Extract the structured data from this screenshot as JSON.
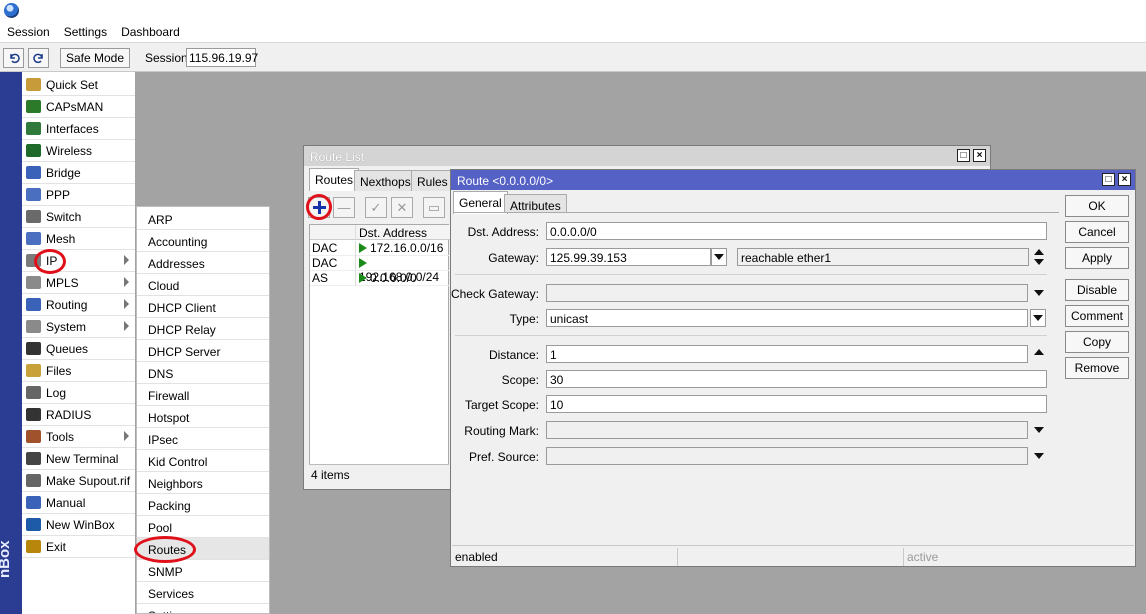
{
  "menubar": {
    "items": [
      "Session",
      "Settings",
      "Dashboard"
    ]
  },
  "toolbar": {
    "undo_icon": "undo-icon",
    "redo_icon": "redo-icon",
    "safe_mode_label": "Safe Mode",
    "session_label": "Session:",
    "session_value": "115.96.19.97"
  },
  "brand": {
    "text": "nBox"
  },
  "sidebar": {
    "items": [
      {
        "label": "Quick Set",
        "icon": "quick-set-icon",
        "arrow": false
      },
      {
        "label": "CAPsMAN",
        "icon": "capsman-icon",
        "arrow": false
      },
      {
        "label": "Interfaces",
        "icon": "interfaces-icon",
        "arrow": false
      },
      {
        "label": "Wireless",
        "icon": "wireless-icon",
        "arrow": false
      },
      {
        "label": "Bridge",
        "icon": "bridge-icon",
        "arrow": false
      },
      {
        "label": "PPP",
        "icon": "ppp-icon",
        "arrow": false
      },
      {
        "label": "Switch",
        "icon": "switch-icon",
        "arrow": false
      },
      {
        "label": "Mesh",
        "icon": "mesh-icon",
        "arrow": false
      },
      {
        "label": "IP",
        "icon": "ip-icon",
        "arrow": true
      },
      {
        "label": "MPLS",
        "icon": "mpls-icon",
        "arrow": true
      },
      {
        "label": "Routing",
        "icon": "routing-icon",
        "arrow": true
      },
      {
        "label": "System",
        "icon": "system-icon",
        "arrow": true
      },
      {
        "label": "Queues",
        "icon": "queues-icon",
        "arrow": false
      },
      {
        "label": "Files",
        "icon": "files-icon",
        "arrow": false
      },
      {
        "label": "Log",
        "icon": "log-icon",
        "arrow": false
      },
      {
        "label": "RADIUS",
        "icon": "radius-icon",
        "arrow": false
      },
      {
        "label": "Tools",
        "icon": "tools-icon",
        "arrow": true
      },
      {
        "label": "New Terminal",
        "icon": "terminal-icon",
        "arrow": false
      },
      {
        "label": "Make Supout.rif",
        "icon": "supout-icon",
        "arrow": false
      },
      {
        "label": "Manual",
        "icon": "manual-icon",
        "arrow": false
      },
      {
        "label": "New WinBox",
        "icon": "winbox-icon",
        "arrow": false
      },
      {
        "label": "Exit",
        "icon": "exit-icon",
        "arrow": false
      }
    ]
  },
  "ip_submenu": {
    "items": [
      "ARP",
      "Accounting",
      "Addresses",
      "Cloud",
      "DHCP Client",
      "DHCP Relay",
      "DHCP Server",
      "DNS",
      "Firewall",
      "Hotspot",
      "IPsec",
      "Kid Control",
      "Neighbors",
      "Packing",
      "Pool",
      "Routes",
      "SNMP",
      "Services",
      "Settings"
    ],
    "highlighted": "Routes"
  },
  "route_list": {
    "title": "Route List",
    "tabs": [
      "Routes",
      "Nexthops",
      "Rules"
    ],
    "column_dst": "Dst. Address",
    "rows": [
      {
        "type": "DAC",
        "dst": "172.16.0.0/16"
      },
      {
        "type": "DAC",
        "dst": "192.168.0.0/24"
      },
      {
        "type": "AS",
        "dst": "0.0.0.0/0"
      }
    ],
    "footer": "4 items"
  },
  "route_dialog": {
    "title": "Route <0.0.0.0/0>",
    "tabs": [
      "General",
      "Attributes"
    ],
    "fields": {
      "dst_address": {
        "label": "Dst. Address:",
        "value": "0.0.0.0/0"
      },
      "gateway": {
        "label": "Gateway:",
        "value": "125.99.39.153",
        "status": "reachable ether1"
      },
      "check_gateway": {
        "label": "Check Gateway:",
        "value": ""
      },
      "type": {
        "label": "Type:",
        "value": "unicast"
      },
      "distance": {
        "label": "Distance:",
        "value": "1"
      },
      "scope": {
        "label": "Scope:",
        "value": "30"
      },
      "target_scope": {
        "label": "Target Scope:",
        "value": "10"
      },
      "routing_mark": {
        "label": "Routing Mark:",
        "value": ""
      },
      "pref_source": {
        "label": "Pref. Source:",
        "value": ""
      }
    },
    "buttons": [
      "OK",
      "Cancel",
      "Apply",
      "Disable",
      "Comment",
      "Copy",
      "Remove"
    ],
    "status": {
      "left": "enabled",
      "middle": "",
      "right": "active"
    }
  },
  "colors": {
    "brand_bar": "#2b3d93",
    "dialog_title": "#5561c4",
    "highlight_ring": "#e0101a",
    "route_flag": "#1a8a1a"
  }
}
